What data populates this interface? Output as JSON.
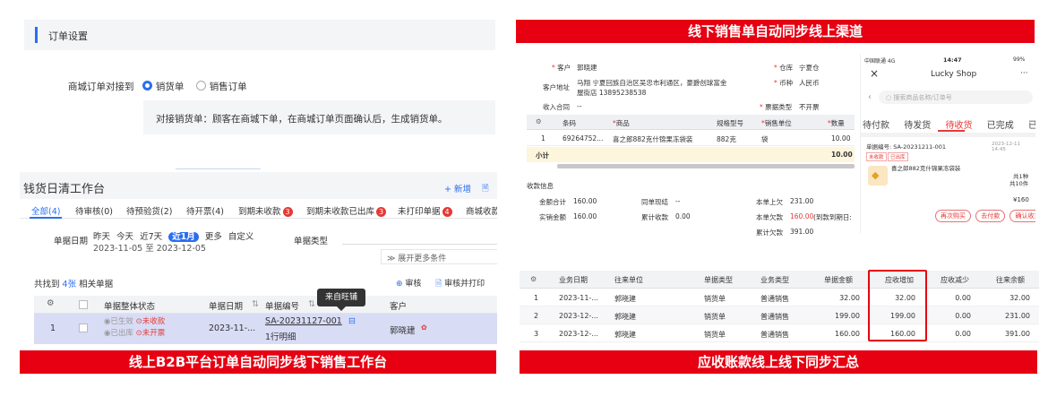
{
  "left": {
    "order_settings": {
      "title": "订单设置",
      "label": "商城订单对接到",
      "options": [
        "销货单",
        "销售订单"
      ],
      "note": "对接销货单：顾客在商城下单，在商城订单页面确认后，生成销货单。"
    },
    "workbench": {
      "title": "钱货日清工作台",
      "new_label": "+ 新增",
      "tabs": [
        {
          "label": "全部(4)",
          "badge": ""
        },
        {
          "label": "待审核(0)",
          "badge": ""
        },
        {
          "label": "待预验货(2)",
          "badge": ""
        },
        {
          "label": "待开票(4)",
          "badge": ""
        },
        {
          "label": "到期未收款",
          "badge": "3"
        },
        {
          "label": "到期未收款已出库",
          "badge": "3"
        },
        {
          "label": "未打印单据",
          "badge": "4"
        },
        {
          "label": "商城收款",
          "badge": ""
        }
      ],
      "date_label": "单据日期",
      "date_options": [
        "昨天",
        "今天",
        "近7天",
        "近1月",
        "更多",
        "自定义"
      ],
      "date_range": "2023-11-05 至 2023-12-05",
      "type_label": "单据类型",
      "expand_label": "展开更多条件",
      "found_prefix": "共找到",
      "found_count": "4张",
      "found_suffix": "相关单据",
      "audit_label": "审核",
      "audit_print_label": "审核并打印",
      "columns": [
        "单据整体状态",
        "单据日期",
        "单据编号",
        "客户"
      ],
      "tooltip": "来自旺铺",
      "row": {
        "index": "1",
        "status": [
          "已生效",
          "已出库"
        ],
        "status_red": [
          "未收款",
          "未开票"
        ],
        "date": "2023-11-...",
        "number": "SA-20231127-001",
        "detail": "1行明细",
        "customer": "郭晓建"
      }
    },
    "caption": "线上B2B平台订单自动同步线下销售工作台"
  },
  "right": {
    "caption_top": "线下销售单自动同步线上渠道",
    "form": {
      "customer_label": "客户",
      "customer": "郭晓建",
      "address_label": "客户地址",
      "address": "马翔 宁夏回族自治区吴忠市利通区，豪爵创球富金屋街店 13895238538",
      "contract_label": "收入合同",
      "contract": "--",
      "warehouse_label": "仓库",
      "warehouse": "宁夏仓",
      "currency_label": "币种",
      "currency": "人民币",
      "invoice_label": "票据类型",
      "invoice": "不开票",
      "columns": [
        "条码",
        "商品",
        "规格型号",
        "销售单位",
        "数量"
      ],
      "row": {
        "index": "1",
        "barcode": "69264752...",
        "product": "喜之郎882克什锦果冻袋装",
        "spec": "882克",
        "unit": "袋",
        "qty": "10.00"
      },
      "subtotal_label": "小计",
      "subtotal": "10.00",
      "pay_title": "收款信息",
      "pay": [
        {
          "label": "金额合计",
          "value": "160.00"
        },
        {
          "label": "实销金额",
          "value": "160.00"
        },
        {
          "label": "同单现结",
          "value": "--"
        },
        {
          "label": "累计收款",
          "value": "0.00"
        },
        {
          "label": "本单上欠",
          "value": "231.00"
        },
        {
          "label": "本单欠款",
          "value": "160.00",
          "extra": "(到款到期日:"
        },
        {
          "label": "累计欠款",
          "value": "391.00"
        }
      ]
    },
    "phone": {
      "status_left": "中国联通 4G",
      "time": "14:47",
      "status_right": "99%",
      "title": "Lucky Shop",
      "close": "×",
      "more": "···",
      "search_placeholder": "搜索商品名称/订单号",
      "tabs": [
        "待付款",
        "待发货",
        "待收货",
        "已完成",
        "已取消"
      ],
      "active_tab": 2,
      "order_no": "单据编号: SA-20231211-001",
      "order_time": "2023-12-11 14:45",
      "tag1": "未收款",
      "tag2": "已出库",
      "product": "喜之郎882克什锦果冻袋装",
      "kinds": "共1种",
      "pieces": "共10件",
      "price": "¥160",
      "buttons": [
        "再次购买",
        "去付款",
        "确认收货"
      ]
    },
    "ledger": {
      "columns": [
        "业务日期",
        "往来单位",
        "单据类型",
        "业务类型",
        "单据金额",
        "应收增加",
        "应收减少",
        "往来余额"
      ],
      "rows": [
        {
          "index": "1",
          "date": "2023-11-...",
          "unit": "郭晓建",
          "type": "销货单",
          "biz": "普通销售",
          "amount": "32.00",
          "inc": "32.00",
          "dec": "0.00",
          "bal": "32.00"
        },
        {
          "index": "2",
          "date": "2023-12-...",
          "unit": "郭晓建",
          "type": "销货单",
          "biz": "普通销售",
          "amount": "199.00",
          "inc": "199.00",
          "dec": "0.00",
          "bal": "231.00"
        },
        {
          "index": "3",
          "date": "2023-12-...",
          "unit": "郭晓建",
          "type": "销货单",
          "biz": "普通销售",
          "amount": "160.00",
          "inc": "160.00",
          "dec": "0.00",
          "bal": "391.00"
        }
      ]
    },
    "caption_bottom": "应收账款线上线下同步汇总"
  },
  "colors": {
    "accent": "#2a6ef0",
    "red": "#e60012",
    "highlight_row": "#d9dcf5"
  }
}
